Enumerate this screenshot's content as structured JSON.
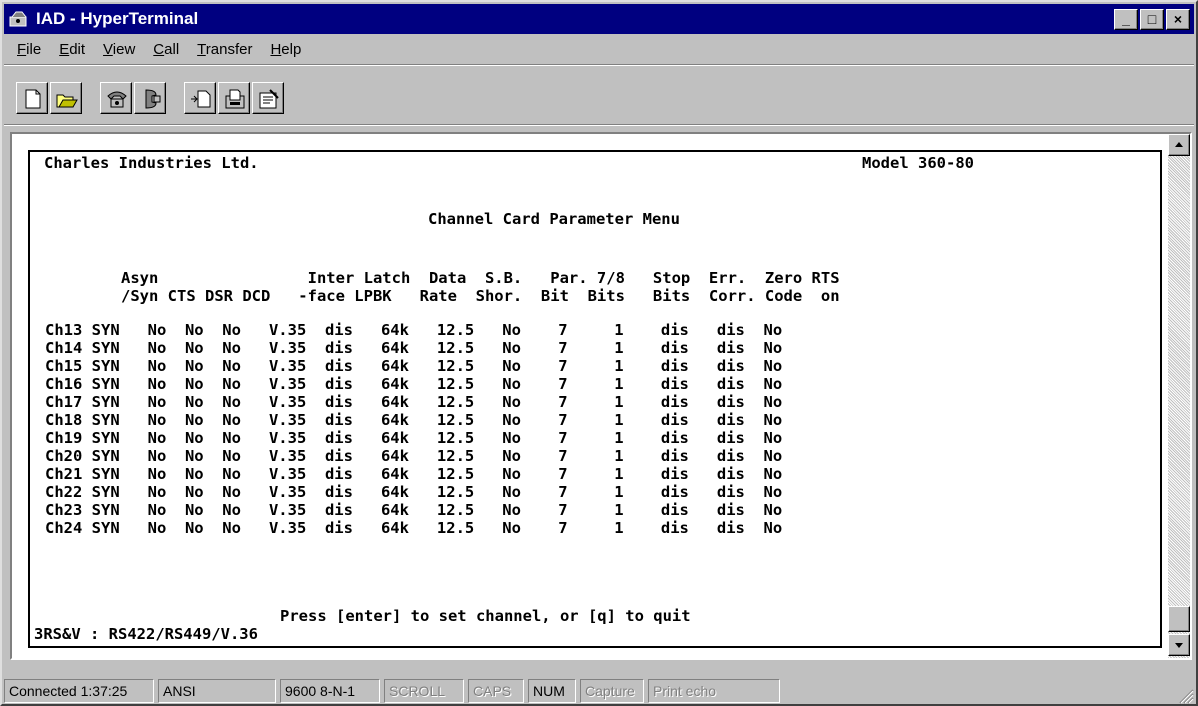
{
  "window": {
    "title": "IAD - HyperTerminal",
    "buttons": {
      "minimize": "_",
      "maximize": "□",
      "close": "×"
    }
  },
  "menubar": {
    "items": [
      {
        "label": "File",
        "mnemonic": "F",
        "rest": "ile"
      },
      {
        "label": "Edit",
        "mnemonic": "E",
        "rest": "dit"
      },
      {
        "label": "View",
        "mnemonic": "V",
        "rest": "iew"
      },
      {
        "label": "Call",
        "mnemonic": "C",
        "rest": "all"
      },
      {
        "label": "Transfer",
        "mnemonic": "T",
        "rest": "ransfer"
      },
      {
        "label": "Help",
        "mnemonic": "H",
        "rest": "elp"
      }
    ]
  },
  "toolbar": {
    "icons": [
      "new-document-icon",
      "open-folder-icon",
      "connect-phone-icon",
      "disconnect-phone-icon",
      "send-file-icon",
      "receive-file-icon",
      "properties-icon"
    ]
  },
  "terminal": {
    "company": "Charles Industries Ltd.",
    "model": "Model 360-80",
    "menu_title": "Channel Card Parameter Menu",
    "header_line1": "Asyn                Inter Latch  Data  S.B.   Par. 7/8   Stop  Err.  Zero RTS",
    "header_line2": "/Syn CTS DSR DCD   -face LPBK   Rate  Shor.  Bit  Bits   Bits  Corr. Code  on",
    "rows": [
      "Ch13 SYN   No  No  No   V.35  dis   64k   12.5   No    7     1    dis   dis  No",
      "Ch14 SYN   No  No  No   V.35  dis   64k   12.5   No    7     1    dis   dis  No",
      "Ch15 SYN   No  No  No   V.35  dis   64k   12.5   No    7     1    dis   dis  No",
      "Ch16 SYN   No  No  No   V.35  dis   64k   12.5   No    7     1    dis   dis  No",
      "Ch17 SYN   No  No  No   V.35  dis   64k   12.5   No    7     1    dis   dis  No",
      "Ch18 SYN   No  No  No   V.35  dis   64k   12.5   No    7     1    dis   dis  No",
      "Ch19 SYN   No  No  No   V.35  dis   64k   12.5   No    7     1    dis   dis  No",
      "Ch20 SYN   No  No  No   V.35  dis   64k   12.5   No    7     1    dis   dis  No",
      "Ch21 SYN   No  No  No   V.35  dis   64k   12.5   No    7     1    dis   dis  No",
      "Ch22 SYN   No  No  No   V.35  dis   64k   12.5   No    7     1    dis   dis  No",
      "Ch23 SYN   No  No  No   V.35  dis   64k   12.5   No    7     1    dis   dis  No",
      "Ch24 SYN   No  No  No   V.35  dis   64k   12.5   No    7     1    dis   dis  No"
    ],
    "prompt": "Press [enter] to set channel, or [q] to quit",
    "status_line": "3RS&V : RS422/RS449/V.36"
  },
  "statusbar": {
    "connected": "Connected 1:37:25",
    "emulation": "ANSI",
    "port": "9600 8-N-1",
    "scroll": "SCROLL",
    "caps": "CAPS",
    "num": "NUM",
    "capture": "Capture",
    "print_echo": "Print echo"
  }
}
